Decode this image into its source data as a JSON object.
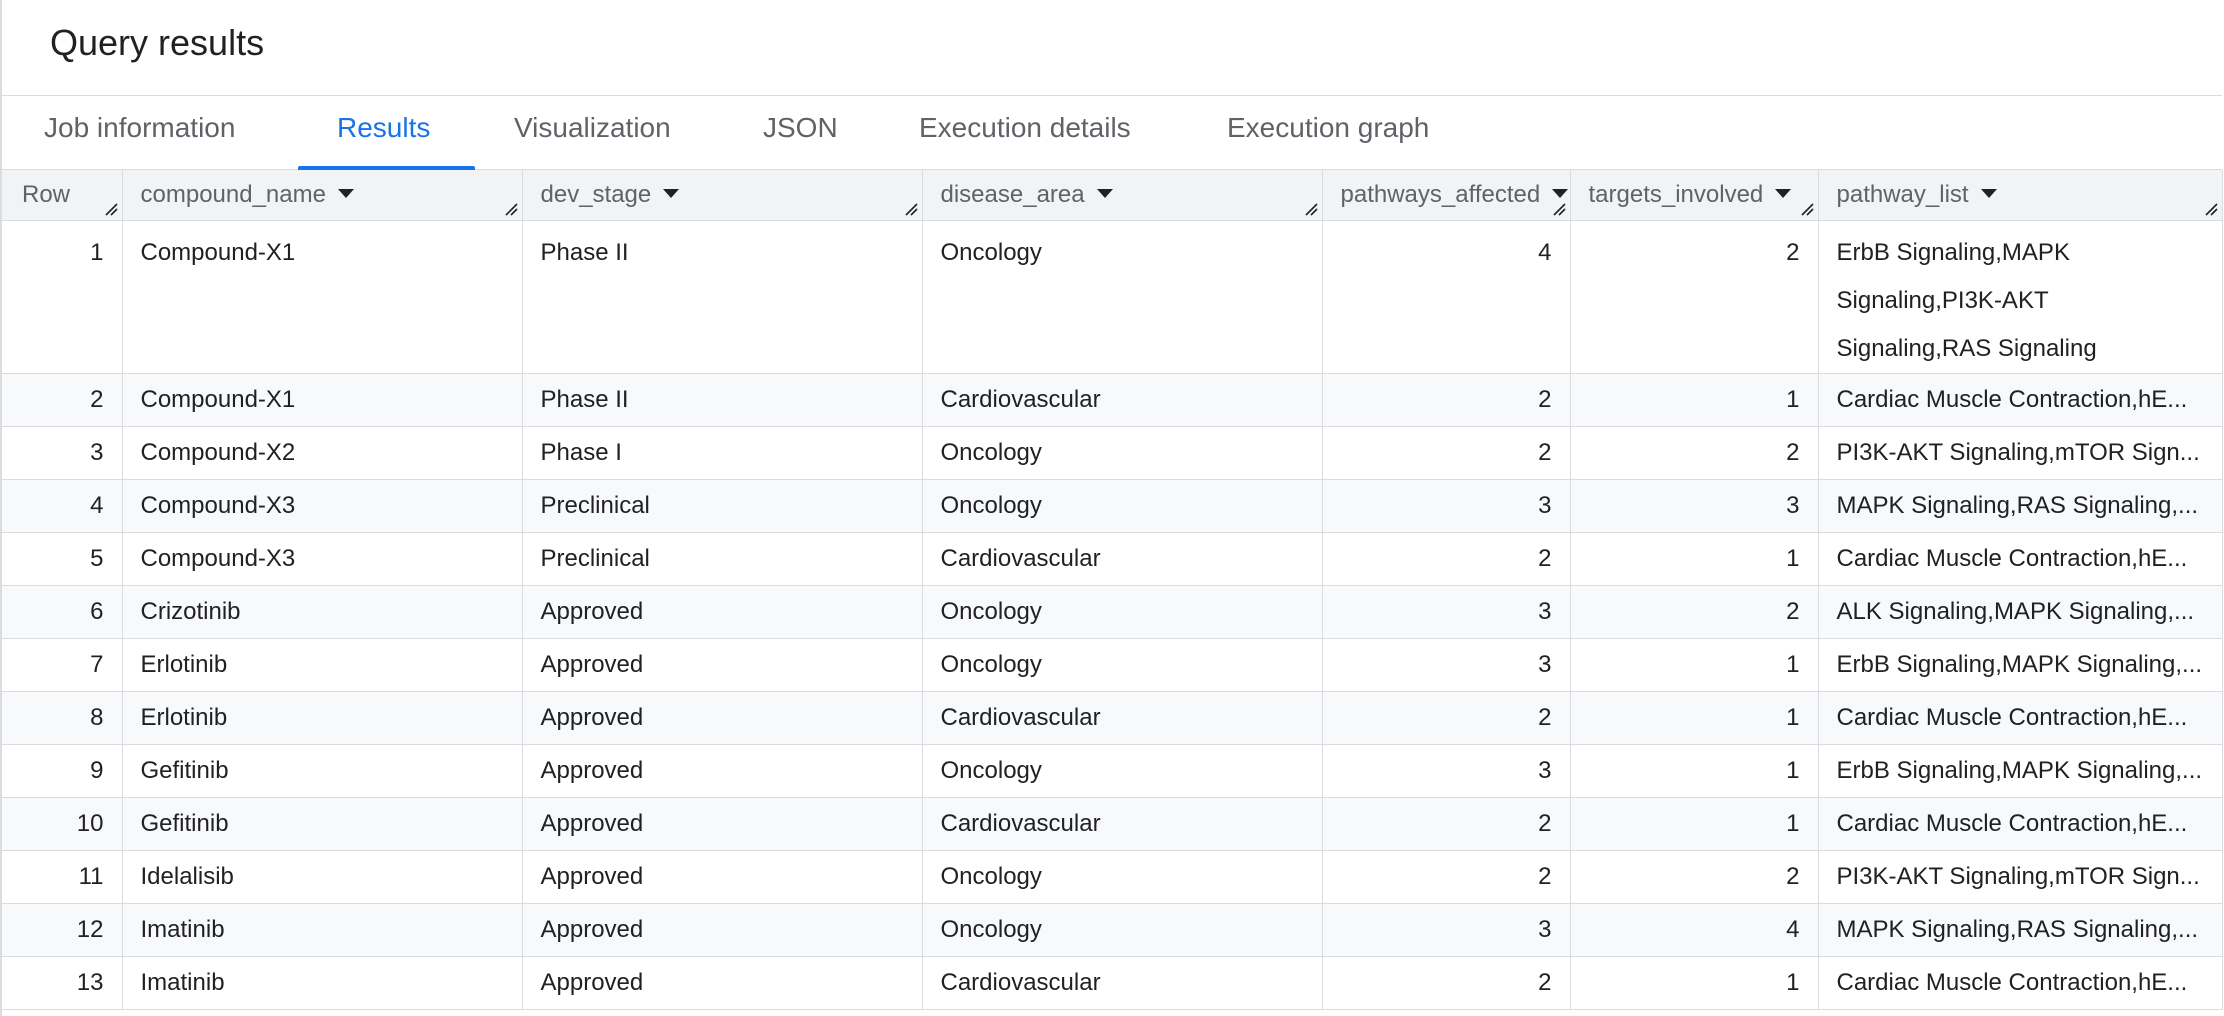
{
  "page": {
    "title": "Query results"
  },
  "tabs": [
    {
      "label": "Job information"
    },
    {
      "label": "Results",
      "active": true
    },
    {
      "label": "Visualization"
    },
    {
      "label": "JSON"
    },
    {
      "label": "Execution details"
    },
    {
      "label": "Execution graph"
    }
  ],
  "table": {
    "columns": [
      "Row",
      "compound_name",
      "dev_stage",
      "disease_area",
      "pathways_affected",
      "targets_involved",
      "pathway_list"
    ],
    "rows": [
      {
        "row": "1",
        "compound_name": "Compound-X1",
        "dev_stage": "Phase II",
        "disease_area": "Oncology",
        "pathways_affected": "4",
        "targets_involved": "2",
        "pathway_list": "ErbB Signaling,MAPK Signaling,PI3K-AKT Signaling,RAS Signaling"
      },
      {
        "row": "2",
        "compound_name": "Compound-X1",
        "dev_stage": "Phase II",
        "disease_area": "Cardiovascular",
        "pathways_affected": "2",
        "targets_involved": "1",
        "pathway_list": "Cardiac Muscle Contraction,hE..."
      },
      {
        "row": "3",
        "compound_name": "Compound-X2",
        "dev_stage": "Phase I",
        "disease_area": "Oncology",
        "pathways_affected": "2",
        "targets_involved": "2",
        "pathway_list": "PI3K-AKT Signaling,mTOR Sign..."
      },
      {
        "row": "4",
        "compound_name": "Compound-X3",
        "dev_stage": "Preclinical",
        "disease_area": "Oncology",
        "pathways_affected": "3",
        "targets_involved": "3",
        "pathway_list": "MAPK Signaling,RAS Signaling,..."
      },
      {
        "row": "5",
        "compound_name": "Compound-X3",
        "dev_stage": "Preclinical",
        "disease_area": "Cardiovascular",
        "pathways_affected": "2",
        "targets_involved": "1",
        "pathway_list": "Cardiac Muscle Contraction,hE..."
      },
      {
        "row": "6",
        "compound_name": "Crizotinib",
        "dev_stage": "Approved",
        "disease_area": "Oncology",
        "pathways_affected": "3",
        "targets_involved": "2",
        "pathway_list": "ALK Signaling,MAPK Signaling,..."
      },
      {
        "row": "7",
        "compound_name": "Erlotinib",
        "dev_stage": "Approved",
        "disease_area": "Oncology",
        "pathways_affected": "3",
        "targets_involved": "1",
        "pathway_list": "ErbB Signaling,MAPK Signaling,..."
      },
      {
        "row": "8",
        "compound_name": "Erlotinib",
        "dev_stage": "Approved",
        "disease_area": "Cardiovascular",
        "pathways_affected": "2",
        "targets_involved": "1",
        "pathway_list": "Cardiac Muscle Contraction,hE..."
      },
      {
        "row": "9",
        "compound_name": "Gefitinib",
        "dev_stage": "Approved",
        "disease_area": "Oncology",
        "pathways_affected": "3",
        "targets_involved": "1",
        "pathway_list": "ErbB Signaling,MAPK Signaling,..."
      },
      {
        "row": "10",
        "compound_name": "Gefitinib",
        "dev_stage": "Approved",
        "disease_area": "Cardiovascular",
        "pathways_affected": "2",
        "targets_involved": "1",
        "pathway_list": "Cardiac Muscle Contraction,hE..."
      },
      {
        "row": "11",
        "compound_name": "Idelalisib",
        "dev_stage": "Approved",
        "disease_area": "Oncology",
        "pathways_affected": "2",
        "targets_involved": "2",
        "pathway_list": "PI3K-AKT Signaling,mTOR Sign..."
      },
      {
        "row": "12",
        "compound_name": "Imatinib",
        "dev_stage": "Approved",
        "disease_area": "Oncology",
        "pathways_affected": "3",
        "targets_involved": "4",
        "pathway_list": "MAPK Signaling,RAS Signaling,..."
      },
      {
        "row": "13",
        "compound_name": "Imatinib",
        "dev_stage": "Approved",
        "disease_area": "Cardiovascular",
        "pathways_affected": "2",
        "targets_involved": "1",
        "pathway_list": "Cardiac Muscle Contraction,hE..."
      }
    ]
  },
  "colors": {
    "accent": "#1a73e8",
    "header_bg": "#f1f3f4",
    "alt_row_bg": "#f8f9fa",
    "border": "#dadce0"
  },
  "icons": {
    "sort": "caret-down-icon",
    "resize": "column-resize-icon"
  }
}
